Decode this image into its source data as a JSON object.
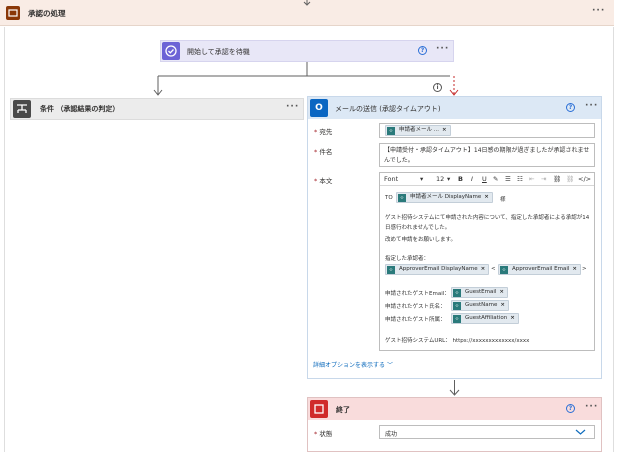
{
  "scope": {
    "title": "承認の処理",
    "more": "···"
  },
  "wait_action": {
    "title": "開始して承認を待機",
    "help": "?",
    "more": "···"
  },
  "condition": {
    "title": "条件 （承認結果の判定）",
    "more": "···"
  },
  "branch_info": "i",
  "email_action": {
    "title": "メールの送信 (承認タイムアウト)",
    "help": "?",
    "more": "···",
    "to": {
      "label": "宛先",
      "chip": "申請者メール ..."
    },
    "subject": {
      "label": "件名",
      "value": "【申請受付・承認タイムアウト】14日感の期限が過ぎましたが承認されませんでした。"
    },
    "body": {
      "label": "本文",
      "toolbar": {
        "font": "Font",
        "size": "12",
        "bold": "B",
        "italic": "I",
        "underline": "U"
      },
      "to_prefix": "TO",
      "to_chip": "申請者メール DisplayName",
      "to_suffix": "様",
      "para1": "ゲスト招待システムにて申請された内容について、指定した承認者による承認が14日感行われませんでした。",
      "para2": "改めて申請をお願いします。",
      "approver_label": "指定した承認者：",
      "approver_chip1": "ApproverEmail DisplayName",
      "lt": "<",
      "approver_chip2": "ApproverEmail Email",
      "gt": ">",
      "guest_email_label": "申請されたゲストEmail：",
      "guest_email_chip": "GuestEmail",
      "guest_name_label": "申請されたゲスト氏名：",
      "guest_name_chip": "GuestName",
      "guest_aff_label": "申請されたゲスト所属：",
      "guest_aff_chip": "GuestAffiliation",
      "url_line": "ゲスト招待システムURL：  https://xxxxxxxxxxxxx/xxxx"
    },
    "advanced": "詳細オプションを表示する"
  },
  "end_action": {
    "title": "終了",
    "help": "?",
    "more": "···",
    "status": {
      "label": "状態",
      "value": "成功"
    }
  },
  "colors": {
    "scope": "#8a3707",
    "approval": "#6c63d6",
    "condition": "#4a4a4a",
    "outlook": "#0a66c2",
    "terminate": "#d02a2a",
    "link": "#0f6cbd"
  }
}
